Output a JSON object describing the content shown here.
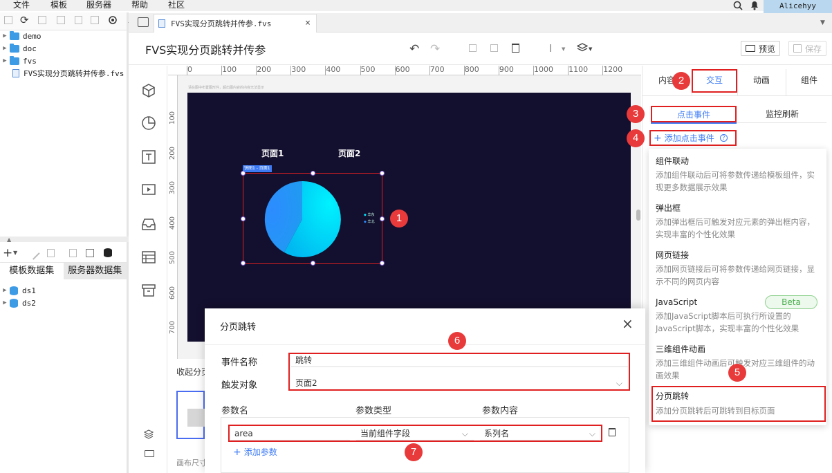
{
  "menu": [
    "文件",
    "模板",
    "服务器",
    "帮助",
    "社区"
  ],
  "user": "Alicehyy",
  "tree": [
    {
      "label": "demo",
      "type": "folder"
    },
    {
      "label": "doc",
      "type": "folder"
    },
    {
      "label": "fvs",
      "type": "folder"
    },
    {
      "label": "FVS实现分页跳转并传参.fvs",
      "type": "file"
    }
  ],
  "dataset_tabs": [
    "模板数据集",
    "服务器数据集"
  ],
  "datasets": [
    "ds1",
    "ds2"
  ],
  "doc_tab": "FVS实现分页跳转并传参.fvs",
  "doc_title": "FVS实现分页跳转并传参",
  "toolbar": {
    "preview": "预览",
    "save": "保存"
  },
  "ruler_h": [
    "0",
    "100",
    "200",
    "300",
    "400",
    "500",
    "600",
    "700",
    "800",
    "900",
    "1000",
    "1100",
    "1200"
  ],
  "ruler_v": [
    "100",
    "200",
    "300",
    "400",
    "500",
    "600",
    "700"
  ],
  "canvas_hint": "请在图中布置图形件，超出图内容的内容无法显示",
  "page_labels": [
    "页面1",
    "页面2"
  ],
  "chart_tag": "饼图1 - 页面1",
  "legend": [
    "华东",
    "华北"
  ],
  "left_bottom": {
    "collect": "收起分页",
    "canvas_size": "画布尺寸"
  },
  "right_tabs": [
    "内容",
    "交互",
    "动画",
    "组件"
  ],
  "sub_tabs": [
    "点击事件",
    "监控刷新"
  ],
  "add_event": "添加点击事件",
  "popup_items": [
    {
      "title": "组件联动",
      "desc": "添加组件联动后可将参数传递给模板组件，实现更多数据展示效果"
    },
    {
      "title": "弹出框",
      "desc": "添加弹出框后可触发对应元素的弹出框内容，实现丰富的个性化效果"
    },
    {
      "title": "网页链接",
      "desc": "添加网页链接后可将参数传递给网页链接，显示不同的网页内容"
    },
    {
      "title": "JavaScript",
      "desc": "添加JavaScript脚本后可执行所设置的JavaScript脚本，实现丰富的个性化效果",
      "badge": "Beta"
    },
    {
      "title": "三维组件动画",
      "desc": "添加三维组件动画后可触发对应三维组件的动画效果"
    },
    {
      "title": "分页跳转",
      "desc": "添加分页跳转后可跳转到目标页面"
    }
  ],
  "dialog": {
    "title": "分页跳转",
    "event_name_label": "事件名称",
    "event_name": "跳转",
    "target_label": "触发对象",
    "target": "页面2",
    "col_headers": [
      "参数名",
      "参数类型",
      "参数内容"
    ],
    "param": {
      "name": "area",
      "type": "当前组件字段",
      "content": "系列名"
    },
    "add_param": "添加参数"
  },
  "badges": [
    "1",
    "2",
    "3",
    "4",
    "5",
    "6",
    "7"
  ],
  "colors": {
    "accent": "#3d7bf5",
    "red": "#e02020",
    "canvas": "#130f2e",
    "badge": "#e83a3a"
  }
}
